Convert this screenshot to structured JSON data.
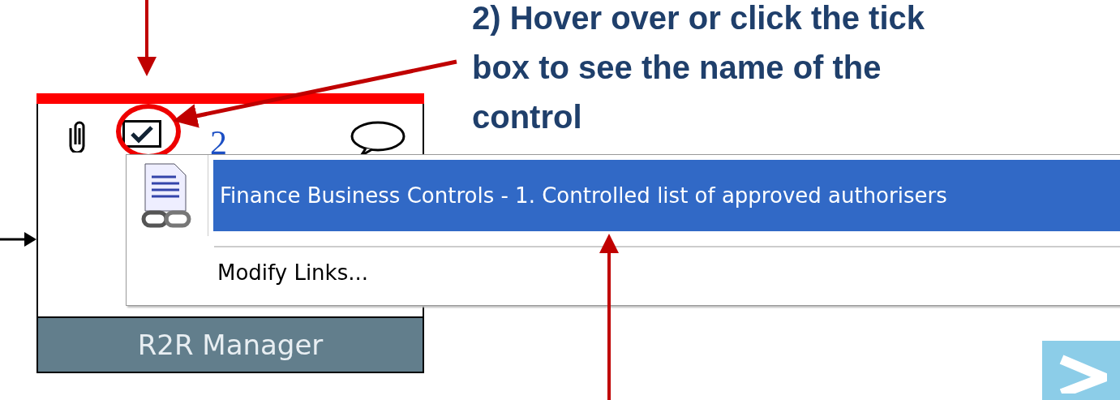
{
  "annotation": {
    "text": "2) Hover over or click the tick box to see the name of the control"
  },
  "process_box": {
    "checked": true,
    "count": "2",
    "label": "R2R Manager"
  },
  "menu": {
    "items": [
      {
        "kind": "link",
        "label": "Finance Business Controls - 1. Controlled list of approved authorisers",
        "selected": true
      },
      {
        "kind": "command",
        "label": "Modify Links...",
        "selected": false
      }
    ]
  }
}
